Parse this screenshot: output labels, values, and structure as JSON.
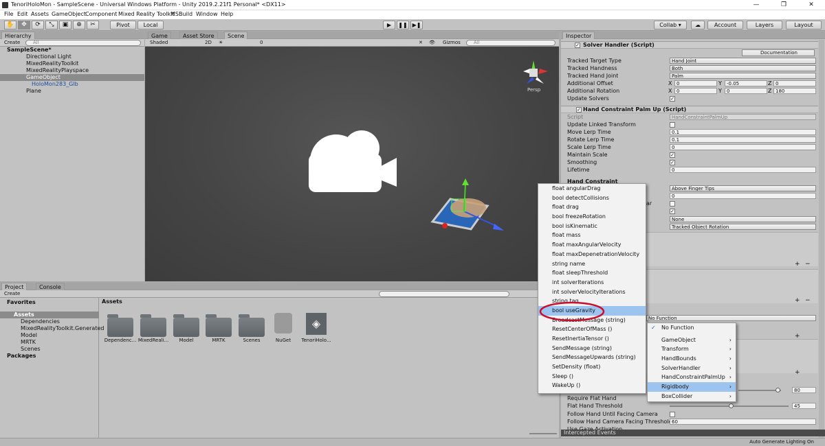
{
  "window": {
    "title": "TenoriHoloMon - SampleScene - Universal Windows Platform - Unity 2019.2.21f1 Personal* <DX11>",
    "minimize": "—",
    "maximize": "❐",
    "close": "✕"
  },
  "menubar": [
    "File",
    "Edit",
    "Assets",
    "GameObject",
    "Component",
    "Mixed Reality Toolkit",
    "MSBuild",
    "Window",
    "Help"
  ],
  "toolbar": {
    "pivot": "Pivot",
    "local": "Local",
    "collab": "Collab ▾",
    "account": "Account",
    "layers": "Layers",
    "layout": "Layout"
  },
  "hierarchy": {
    "tab": "Hierarchy",
    "create": "Create",
    "search": "All",
    "items": [
      "SampleScene*",
      "Directional Light",
      "MixedRealityToolkit",
      "MixedRealityPlayspace",
      "GameObject",
      "HoloMon283_Glb",
      "Plane"
    ]
  },
  "scene_tabs": {
    "game": "Game",
    "asset_store": "Asset Store",
    "scene": "Scene",
    "shaded": "Shaded",
    "twod": "2D",
    "gizmos": "Gizmos",
    "search": "All",
    "effects_count": "0",
    "persp": "Persp"
  },
  "inspector": {
    "tab": "Inspector",
    "solver_handler": {
      "title": "Solver Handler (Script)",
      "documentation": "Documentation",
      "rows": [
        {
          "label": "Tracked Target Type",
          "value": "Hand Joint"
        },
        {
          "label": "Tracked Handness",
          "value": "Both"
        },
        {
          "label": "Tracked Hand Joint",
          "value": "Palm"
        }
      ],
      "additional_offset": {
        "label": "Additional Offset",
        "x": "0",
        "y": "-0.05",
        "z": "0"
      },
      "additional_rotation": {
        "label": "Additional Rotation",
        "x": "0",
        "y": "0",
        "z": "180"
      },
      "update_solvers": "Update Solvers"
    },
    "palm_up": {
      "title": "Hand Constraint Palm Up (Script)",
      "script_label": "Script",
      "script_value": "HandConstraintPalmUp",
      "rows": [
        {
          "label": "Update Linked Transform",
          "value": ""
        },
        {
          "label": "Move Lerp Time",
          "value": "0.1"
        },
        {
          "label": "Rotate Lerp Time",
          "value": "0.1"
        },
        {
          "label": "Scale Lerp Time",
          "value": "0"
        },
        {
          "label": "Maintain Scale",
          "value": ""
        },
        {
          "label": "Smoothing",
          "value": ""
        },
        {
          "label": "Lifetime",
          "value": "0"
        }
      ],
      "section": "Hand Constraint",
      "safe_zone": "Above Finger Tips",
      "offset_value": "0",
      "none_value": "None",
      "rotation_value": "Tracked Object Rotation",
      "fragment": "ar"
    },
    "no_function": "No Function",
    "slider1_value": "80",
    "slider2_value": "45",
    "bottom_rows": [
      "Require Flat Hand",
      "Flat Hand Threshold",
      "Follow Hand Until Facing Camera",
      "Follow Hand Camera Facing Threshold An",
      "Use Gaze Activation"
    ],
    "threshold_value": "60",
    "intercepted": "Intercepted Events"
  },
  "project": {
    "tab": "Project",
    "console": "Console",
    "create": "Create",
    "favorites": "Favorites",
    "assets": "Assets",
    "packages": "Packages",
    "tree": [
      "Dependencies",
      "MixedRealityToolkit.Generated",
      "Model",
      "MRTK",
      "Scenes"
    ],
    "items": [
      "Dependenc...",
      "MixedReali...",
      "Model",
      "MRTK",
      "Scenes",
      "NuGet",
      "TenoriHolo..."
    ],
    "assets_header": "Assets"
  },
  "status": {
    "text": "Auto Generate Lighting On"
  },
  "rigidbody_menu": [
    "float angularDrag",
    "bool detectCollisions",
    "float drag",
    "bool freezeRotation",
    "bool isKinematic",
    "float mass",
    "float maxAngularVelocity",
    "float maxDepenetrationVelocity",
    "string name",
    "float sleepThreshold",
    "int solverIterations",
    "int solverVelocityIterations",
    "string tag",
    "bool useGravity",
    "BroadcastMessage (string)",
    "ResetCenterOfMass ()",
    "ResetInertiaTensor ()",
    "SendMessage (string)",
    "SendMessageUpwards (string)",
    "SetDensity (float)",
    "Sleep ()",
    "WakeUp ()"
  ],
  "rigidbody_selected": "bool useGravity",
  "function_menu": {
    "no_function": "No Function",
    "items": [
      "GameObject",
      "Transform",
      "HandBounds",
      "SolverHandler",
      "HandConstraintPalmUp",
      "Rigidbody",
      "BoxCollider"
    ],
    "selected": "Rigidbody"
  },
  "colors": {
    "highlight": "#9cc4ef",
    "annotation": "#c8102e",
    "scene_bg": "#474747"
  }
}
